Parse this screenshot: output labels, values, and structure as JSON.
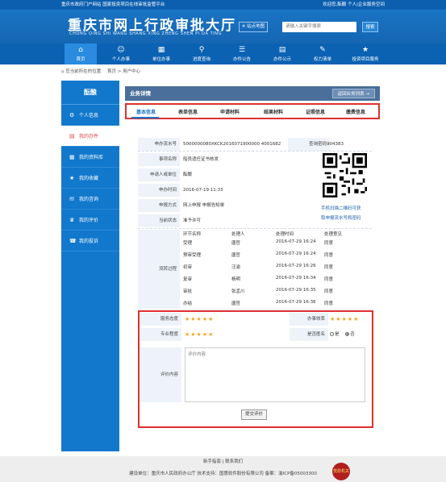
{
  "topbar": {
    "left": "重庆市政府门户网站  国家投资项目在线审批监管平台",
    "right": "欢迎您,酝酿  个人|企业服务空间"
  },
  "header": {
    "logo": "重庆市网上行政审批大厅",
    "logo_sub": "CHONG QING SHI WANG SHANG XING ZHENG SHEN PI DA TING",
    "site_map": "站点地图",
    "search_placeholder": "请输入关键字搜索",
    "search_button": "搜索"
  },
  "nav": [
    {
      "label": "首页",
      "icon": "⌂"
    },
    {
      "label": "个人办事",
      "icon": "☺"
    },
    {
      "label": "单位办事",
      "icon": "▦"
    },
    {
      "label": "进度查询",
      "icon": "⚲"
    },
    {
      "label": "办件公告",
      "icon": "☰"
    },
    {
      "label": "办件公示",
      "icon": "▤"
    },
    {
      "label": "权力清单",
      "icon": "✎"
    },
    {
      "label": "投资项目服务",
      "icon": "★"
    }
  ],
  "breadcrumb": {
    "prefix": "您当前所在的位置",
    "home": "首页",
    "sep": ">",
    "current": "用户中心"
  },
  "sidebar": {
    "title": "酝酿",
    "items": [
      {
        "label": "个人信息",
        "icon": "⚙"
      },
      {
        "label": "我的办件",
        "icon": "▤"
      },
      {
        "label": "我的资料库",
        "icon": "▦"
      },
      {
        "label": "我的收藏",
        "icon": "★"
      },
      {
        "label": "我的咨询",
        "icon": "✉"
      },
      {
        "label": "我的评价",
        "icon": "♛"
      },
      {
        "label": "我的投诉",
        "icon": "☎"
      }
    ]
  },
  "main": {
    "title": "业务详情",
    "back": "返回业务列表 →",
    "tabs": [
      "基本信息",
      "表单信息",
      "申请材料",
      "结果材料",
      "证照信息",
      "缴费信息"
    ]
  },
  "info": {
    "serial_label": "申办流水号",
    "serial": "5000000080XKCK2016071900000 4001682",
    "query_label": "查询密码",
    "query": "904383",
    "item_label": "事项名称",
    "item": "船员适任证书核发",
    "org_label": "申请人或单位",
    "org": "酝酿",
    "time_label": "申办时间",
    "time": "2016-07-19 11:33",
    "method_label": "申报方式",
    "method": "网上申报  申报告知单",
    "state_label": "当前状态",
    "state": "准予许可",
    "qr1": "手机扫描二维码可获",
    "qr2": "取申报流水号和密码",
    "flow_label": "流转过程",
    "flow_head": [
      "环节名称",
      "处理人",
      "处理时间",
      "处理意见"
    ],
    "flow": [
      [
        "受理",
        "唐哲",
        "2016-07-29 16:24",
        "同意"
      ],
      [
        "预审受理",
        "唐哲",
        "2016-07-29 16:24",
        "同意"
      ],
      [
        "初审",
        "汪渝",
        "2016-07-29 16:26",
        "同意"
      ],
      [
        "复审",
        "杨明",
        "2016-07-29 16:34",
        "同意"
      ],
      [
        "审批",
        "张孟川",
        "2016-07-29 16:35",
        "同意"
      ],
      [
        "办结",
        "唐哲",
        "2016-07-29 16:36",
        "同意"
      ]
    ]
  },
  "rating": {
    "attitude": "服务态度",
    "efficiency": "办事效率",
    "profession": "专业程度",
    "anonymous": "是否匿名",
    "stars": "★★★★★",
    "yes": "是",
    "no": "否",
    "content_label": "评价内容",
    "placeholder": "评价内容",
    "submit": "提交评价"
  },
  "footer": {
    "links": "新手指南 | 联系我们",
    "info": "建设单位：重庆市人民政府办公厅   技术支持：国惠软件股份有限公司   备案：渝ICP备05003300",
    "badge": "党政机关"
  }
}
